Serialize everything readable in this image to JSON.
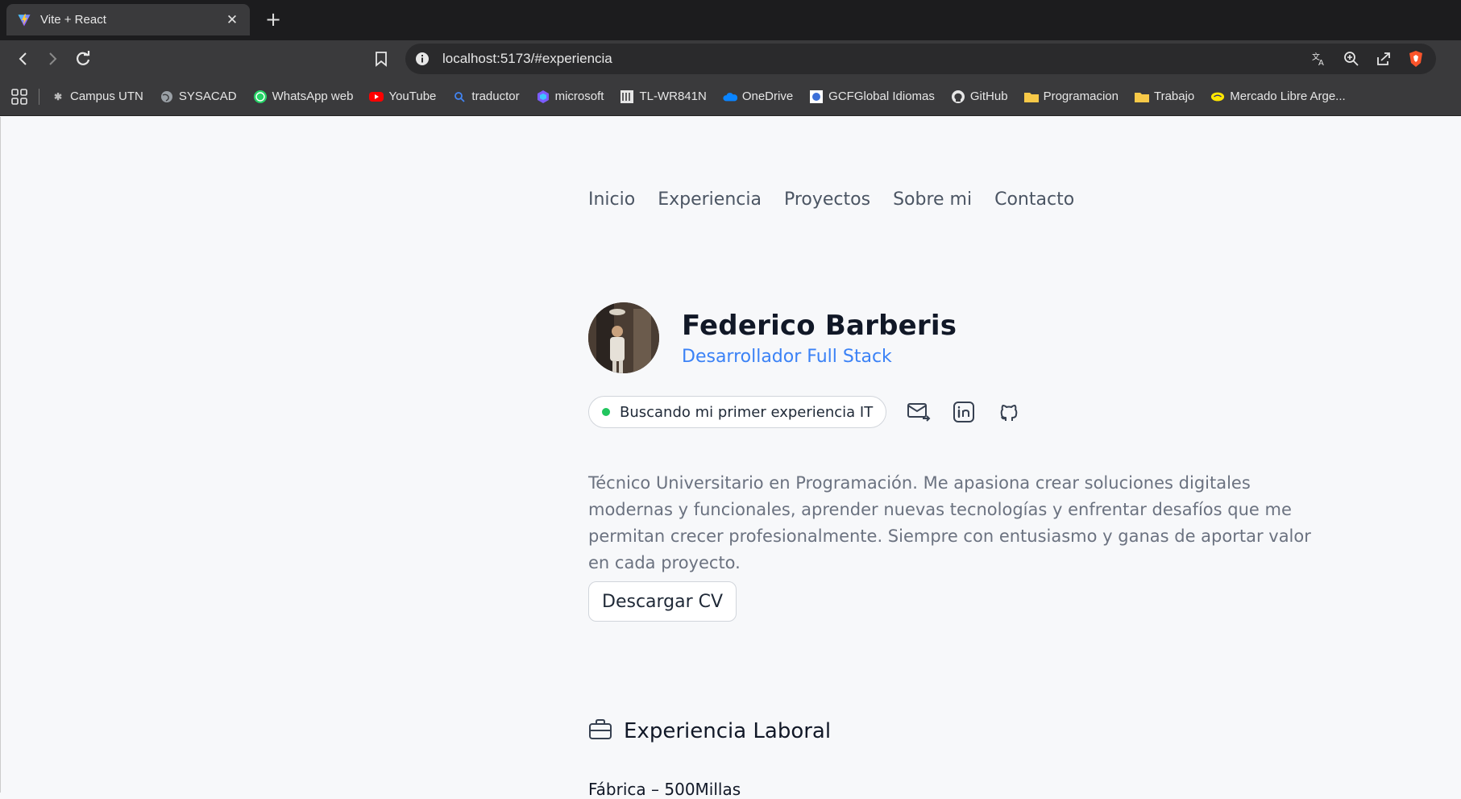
{
  "browser": {
    "tab_title": "Vite + React",
    "url": "localhost:5173/#experiencia",
    "bookmarks": [
      {
        "label": "Campus UTN",
        "icon": "utn-icon"
      },
      {
        "label": "SYSACAD",
        "icon": "globe-icon"
      },
      {
        "label": "WhatsApp web",
        "icon": "whatsapp-icon"
      },
      {
        "label": "YouTube",
        "icon": "youtube-icon"
      },
      {
        "label": "traductor",
        "icon": "search-icon"
      },
      {
        "label": "microsoft",
        "icon": "copilot-icon"
      },
      {
        "label": "TL-WR841N",
        "icon": "router-icon"
      },
      {
        "label": "OneDrive",
        "icon": "cloud-icon"
      },
      {
        "label": "GCFGlobal Idiomas",
        "icon": "gcf-icon"
      },
      {
        "label": "GitHub",
        "icon": "github-icon"
      },
      {
        "label": "Programacion",
        "icon": "folder-icon"
      },
      {
        "label": "Trabajo",
        "icon": "folder-icon"
      },
      {
        "label": "Mercado Libre Arge...",
        "icon": "mercadolibre-icon"
      }
    ]
  },
  "nav": {
    "items": [
      "Inicio",
      "Experiencia",
      "Proyectos",
      "Sobre mi",
      "Contacto"
    ]
  },
  "profile": {
    "name": "Federico Barberis",
    "role": "Desarrollador Full Stack",
    "status": "Buscando mi primer experiencia IT",
    "status_color": "#22c55e"
  },
  "bio": "Técnico Universitario en Programación. Me apasiona crear soluciones digitales modernas y funcionales, aprender nuevas tecnologías y enfrentar desafíos que me permitan crecer profesionalmente. Siempre con entusiasmo y ganas de aportar valor en cada proyecto.",
  "cv_button": "Descargar CV",
  "experience": {
    "title": "Experiencia Laboral",
    "first_job": "Fábrica – 500Millas"
  },
  "colors": {
    "accent": "#3b82f6",
    "page_bg": "#f7f8fa",
    "chrome_bg": "#3a3a3c"
  }
}
